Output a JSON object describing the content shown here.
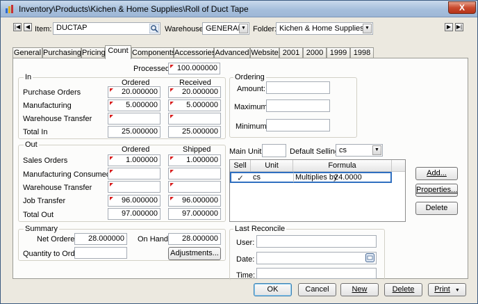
{
  "window": {
    "title": "Inventory\\Products\\Kichen & Home Supplies\\Roll of Duct Tape",
    "close": "X"
  },
  "header": {
    "item_label": "Item:",
    "item_value": "DUCTAP",
    "warehouse_label": "Warehouse:",
    "warehouse_value": "GENERAL",
    "folder_label": "Folder:",
    "folder_value": "Kichen & Home Supplies"
  },
  "tabs": [
    "General",
    "Purchasing",
    "Pricing",
    "Count",
    "Components",
    "Accessories",
    "Advanced",
    "Website",
    "2001",
    "2000",
    "1999",
    "1998"
  ],
  "active_tab": "Count",
  "processed": {
    "label": "Processed:",
    "value": "100.000000"
  },
  "in_group": {
    "title": "In",
    "col1": "Ordered",
    "col2": "Received",
    "rows": [
      {
        "label": "Purchase Orders",
        "ordered": "20.000000",
        "received": "20.000000"
      },
      {
        "label": "Manufacturing",
        "ordered": "5.000000",
        "received": "5.000000"
      },
      {
        "label": "Warehouse Transfer",
        "ordered": "",
        "received": ""
      },
      {
        "label": "Total In",
        "ordered": "25.000000",
        "received": "25.000000"
      }
    ]
  },
  "out_group": {
    "title": "Out",
    "col1": "Ordered",
    "col2": "Shipped",
    "rows": [
      {
        "label": "Sales Orders",
        "ordered": "1.000000",
        "shipped": "1.000000"
      },
      {
        "label": "Manufacturing Consumed",
        "ordered": "",
        "shipped": ""
      },
      {
        "label": "Warehouse Transfer",
        "ordered": "",
        "shipped": ""
      },
      {
        "label": "Job Transfer",
        "ordered": "96.000000",
        "shipped": "96.000000"
      },
      {
        "label": "Total Out",
        "ordered": "97.000000",
        "shipped": "97.000000"
      }
    ]
  },
  "summary": {
    "title": "Summary",
    "net_ordered_label": "Net Ordered:",
    "net_ordered_value": "28.000000",
    "on_hand_label": "On Hand:",
    "on_hand_value": "28.000000",
    "qty_to_order_label": "Quantity to Order:",
    "qty_to_order_value": "",
    "adjustments": "Adjustments..."
  },
  "ordering": {
    "title": "Ordering",
    "amount_label": "Amount:",
    "maximum_label": "Maximum:",
    "minimum_label": "Minimum:"
  },
  "units": {
    "main_unit_label": "Main Unit:",
    "main_unit_value": "",
    "default_selling_label": "Default Selling:",
    "default_selling_value": "cs",
    "columns": [
      "Sell",
      "Unit",
      "Formula"
    ],
    "rows": [
      {
        "sell": "✓",
        "unit": "cs",
        "formula": "Multiplies by",
        "factor": "24.0000"
      }
    ],
    "add": "Add...",
    "properties": "Properties...",
    "delete": "Delete"
  },
  "reconcile": {
    "title": "Last Reconcile",
    "user_label": "User:",
    "date_label": "Date:",
    "time_label": "Time:"
  },
  "footer": {
    "ok": "OK",
    "cancel": "Cancel",
    "new": "New",
    "delete": "Delete",
    "print": "Print"
  }
}
